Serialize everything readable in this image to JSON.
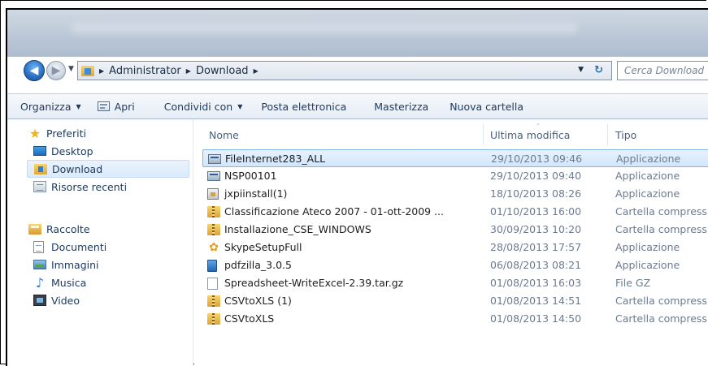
{
  "nav": {
    "back_glyph": "◀",
    "forward_glyph": "▶",
    "dropdown_glyph": "▼"
  },
  "address": {
    "breadcrumbs": [
      "Administrator",
      "Download"
    ],
    "separator": "▶",
    "dropdown_glyph": "▼",
    "refresh_glyph": "↻"
  },
  "search": {
    "placeholder": "Cerca Download"
  },
  "toolbar": {
    "organize": "Organizza",
    "open": "Apri",
    "share": "Condividi con",
    "email": "Posta elettronica",
    "burn": "Masterizza",
    "new_folder": "Nuova cartella",
    "caret": "▼"
  },
  "sidebar": {
    "favorites": {
      "title": "Preferiti",
      "items": [
        {
          "label": "Desktop",
          "icon": "desktop-icon"
        },
        {
          "label": "Download",
          "icon": "download-folder-icon",
          "selected": true
        },
        {
          "label": "Risorse recenti",
          "icon": "recent-places-icon"
        }
      ]
    },
    "libraries": {
      "title": "Raccolte",
      "items": [
        {
          "label": "Documenti",
          "icon": "documents-icon"
        },
        {
          "label": "Immagini",
          "icon": "pictures-icon"
        },
        {
          "label": "Musica",
          "icon": "music-icon"
        },
        {
          "label": "Video",
          "icon": "video-icon"
        }
      ]
    }
  },
  "columns": {
    "name": "Nome",
    "modified": "Ultima modifica",
    "type": "Tipo"
  },
  "files": [
    {
      "name": "FileInternet283_ALL",
      "modified": "29/10/2013 09:46",
      "type": "Applicazione",
      "icon": "application-icon",
      "selected": true
    },
    {
      "name": "NSP00101",
      "modified": "29/10/2013 09:40",
      "type": "Applicazione",
      "icon": "application-icon"
    },
    {
      "name": "jxpiinstall(1)",
      "modified": "18/10/2013 08:26",
      "type": "Applicazione",
      "icon": "installer-icon"
    },
    {
      "name": "Classificazione Ateco 2007 - 01-ott-2009 ...",
      "modified": "01/10/2013 16:00",
      "type": "Cartella compress",
      "icon": "zip-folder-icon"
    },
    {
      "name": "Installazione_CSE_WINDOWS",
      "modified": "30/09/2013 10:20",
      "type": "Cartella compress",
      "icon": "zip-folder-icon"
    },
    {
      "name": "SkypeSetupFull",
      "modified": "28/08/2013 17:57",
      "type": "Applicazione",
      "icon": "skype-icon"
    },
    {
      "name": "pdfzilla_3.0.5",
      "modified": "06/08/2013 08:21",
      "type": "Applicazione",
      "icon": "pdf-app-icon"
    },
    {
      "name": "Spreadsheet-WriteExcel-2.39.tar.gz",
      "modified": "01/08/2013 16:03",
      "type": "File GZ",
      "icon": "gz-file-icon"
    },
    {
      "name": "CSVtoXLS (1)",
      "modified": "01/08/2013 14:51",
      "type": "Cartella compress",
      "icon": "zip-folder-icon"
    },
    {
      "name": "CSVtoXLS",
      "modified": "01/08/2013 14:50",
      "type": "Cartella compress",
      "icon": "zip-folder-icon"
    }
  ]
}
